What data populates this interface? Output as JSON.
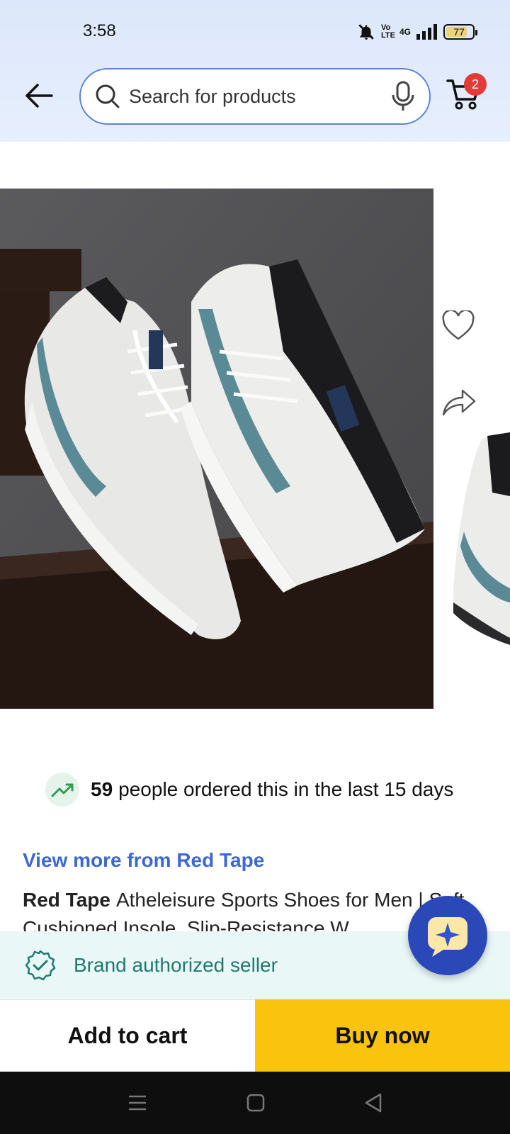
{
  "status_bar": {
    "time": "3:58",
    "network_label": "4G",
    "volte_label": "Vo LTE",
    "battery": "77",
    "icons": [
      "mute-icon",
      "signal-icon",
      "battery-icon"
    ]
  },
  "header": {
    "search_placeholder": "Search for products",
    "cart_count": "2"
  },
  "product": {
    "ordered_count": "59",
    "ordered_text": "people ordered this in the last 15 days",
    "brand_link": "View more from Red Tape",
    "brand": "Red Tape",
    "title_rest": "Atheleisure Sports Shoes for Men | Soft Cushioned Insole, Slip-Resistance W",
    "seller_text": "Brand authorized seller"
  },
  "actions": {
    "add_to_cart": "Add to cart",
    "buy_now": "Buy now"
  },
  "colors": {
    "accent": "#3d67d3",
    "buy_now": "#f9c30e",
    "seller_bg": "#e9f7f6",
    "seller_text": "#1f7a6e",
    "badge": "#e33a3a"
  }
}
